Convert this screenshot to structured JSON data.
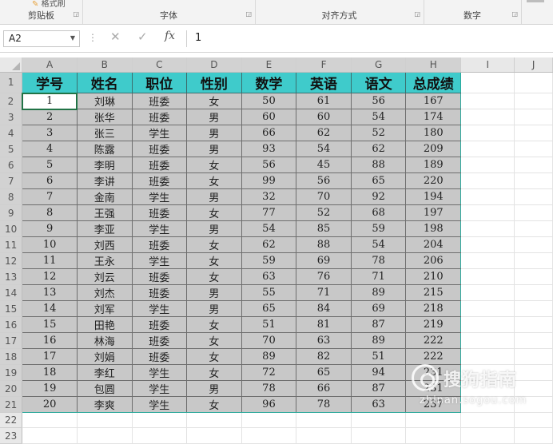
{
  "ribbon": {
    "clipboard_partial": "格式刷",
    "groups": [
      {
        "label": "剪贴板"
      },
      {
        "label": "字体"
      },
      {
        "label": "对齐方式"
      },
      {
        "label": "数字"
      }
    ]
  },
  "formula_bar": {
    "name_box": "A2",
    "fx": "fx",
    "value": "1"
  },
  "sheet": {
    "columns": [
      "A",
      "B",
      "C",
      "D",
      "E",
      "F",
      "G",
      "H",
      "I",
      "J"
    ],
    "rows": [
      "1",
      "2",
      "3",
      "4",
      "5",
      "6",
      "7",
      "8",
      "9",
      "10",
      "11",
      "12",
      "13",
      "14",
      "15",
      "16",
      "17",
      "18",
      "19",
      "20",
      "21",
      "22",
      "23"
    ],
    "header_cells": [
      "学号",
      "姓名",
      "职位",
      "性别",
      "数学",
      "英语",
      "语文",
      "总成绩"
    ],
    "data": [
      [
        "1",
        "刘琳",
        "班委",
        "女",
        "50",
        "61",
        "56",
        "167"
      ],
      [
        "2",
        "张华",
        "班委",
        "男",
        "60",
        "60",
        "54",
        "174"
      ],
      [
        "3",
        "张三",
        "学生",
        "男",
        "66",
        "62",
        "52",
        "180"
      ],
      [
        "4",
        "陈露",
        "班委",
        "男",
        "93",
        "54",
        "62",
        "209"
      ],
      [
        "5",
        "李明",
        "班委",
        "女",
        "56",
        "45",
        "88",
        "189"
      ],
      [
        "6",
        "李讲",
        "班委",
        "女",
        "99",
        "56",
        "65",
        "220"
      ],
      [
        "7",
        "金南",
        "学生",
        "男",
        "32",
        "70",
        "92",
        "194"
      ],
      [
        "8",
        "王强",
        "班委",
        "女",
        "77",
        "52",
        "68",
        "197"
      ],
      [
        "9",
        "李亚",
        "学生",
        "男",
        "54",
        "85",
        "59",
        "198"
      ],
      [
        "10",
        "刘西",
        "班委",
        "女",
        "62",
        "88",
        "54",
        "204"
      ],
      [
        "11",
        "王永",
        "学生",
        "女",
        "59",
        "69",
        "78",
        "206"
      ],
      [
        "12",
        "刘云",
        "班委",
        "女",
        "63",
        "76",
        "71",
        "210"
      ],
      [
        "13",
        "刘杰",
        "班委",
        "男",
        "55",
        "71",
        "89",
        "215"
      ],
      [
        "14",
        "刘军",
        "学生",
        "男",
        "65",
        "84",
        "69",
        "218"
      ],
      [
        "15",
        "田艳",
        "班委",
        "女",
        "51",
        "81",
        "87",
        "219"
      ],
      [
        "16",
        "林海",
        "班委",
        "女",
        "70",
        "63",
        "89",
        "222"
      ],
      [
        "17",
        "刘娟",
        "班委",
        "女",
        "89",
        "82",
        "51",
        "222"
      ],
      [
        "18",
        "李红",
        "学生",
        "女",
        "72",
        "65",
        "94",
        "231"
      ],
      [
        "19",
        "包圆",
        "学生",
        "男",
        "78",
        "66",
        "87",
        "231"
      ],
      [
        "20",
        "李爽",
        "学生",
        "女",
        "96",
        "78",
        "63",
        "237"
      ]
    ]
  },
  "watermark": {
    "text": "搜狗指南",
    "url": "zhinan.sogou.com"
  },
  "colors": {
    "header_fill": "#3fcbcb",
    "data_fill": "#c8c8c8",
    "selection_border": "#217346"
  }
}
